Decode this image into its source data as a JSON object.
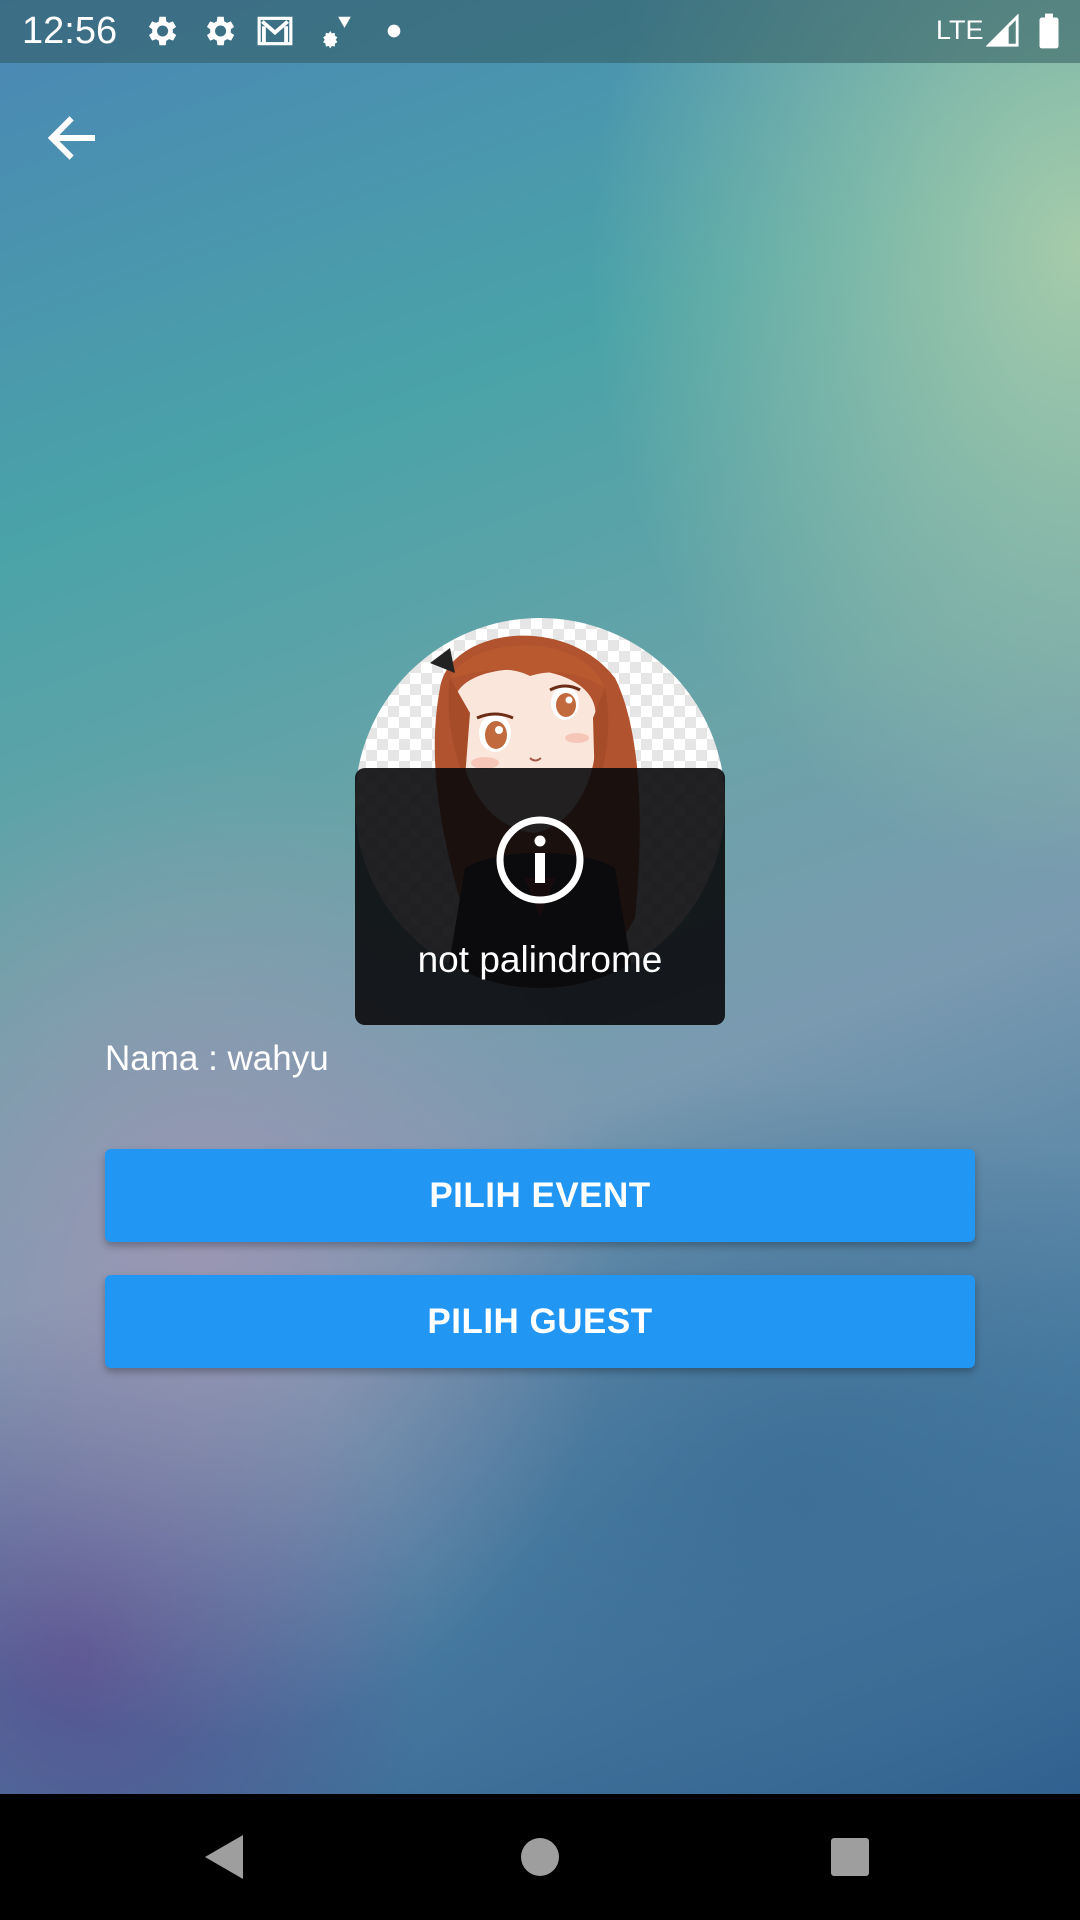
{
  "status_bar": {
    "time": "12:56",
    "network": "LTE",
    "icons": [
      "settings-icon",
      "settings-icon",
      "gmail-icon",
      "sync-icon",
      "dot-icon",
      "signal-icon",
      "battery-icon"
    ]
  },
  "header": {
    "back_icon": "arrow-back-icon"
  },
  "toast": {
    "icon": "info-icon",
    "message": "not palindrome"
  },
  "profile": {
    "name_text": "Nama : wahyu"
  },
  "buttons": {
    "event_label": "PILIH EVENT",
    "guest_label": "PILIH GUEST"
  },
  "colors": {
    "primary": "#2196f3",
    "toast_bg": "#0a0a0c"
  },
  "nav_bar": {
    "icons": [
      "back-triangle-icon",
      "home-circle-icon",
      "recents-square-icon"
    ]
  }
}
